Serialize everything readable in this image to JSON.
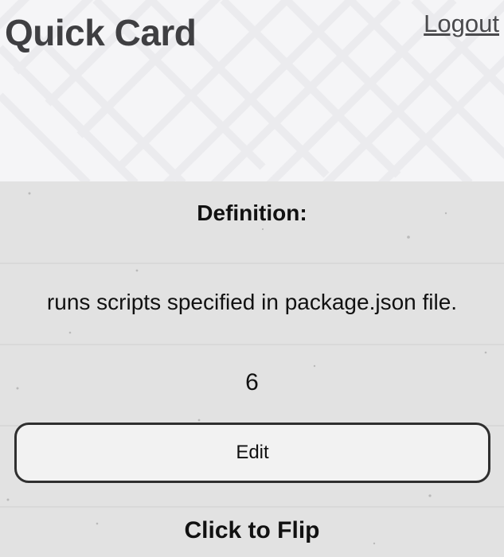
{
  "header": {
    "title": "Quick Card",
    "logout_label": "Logout"
  },
  "card": {
    "heading": "Definition:",
    "text": "runs scripts specified in package.json file.",
    "count": "6",
    "edit_label": "Edit",
    "flip_label": "Click to Flip"
  },
  "colors": {
    "header_background": "#f5f5f7",
    "card_background": "#e2e2e2",
    "title_text": "#3f3f42",
    "button_border": "#2f2f2f"
  }
}
